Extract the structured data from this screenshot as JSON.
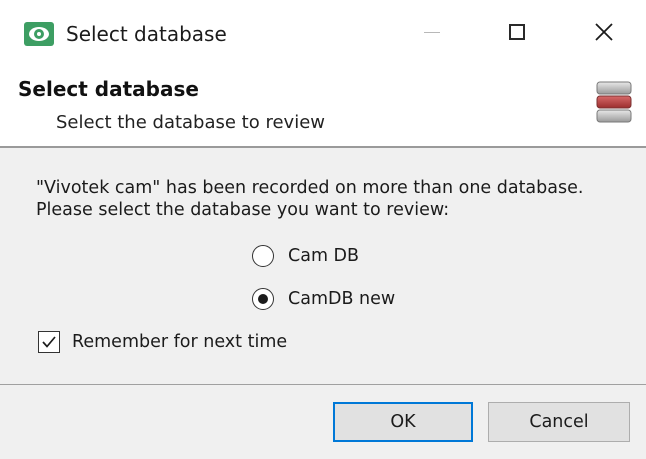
{
  "window": {
    "title": "Select database",
    "controls": {
      "minimize": "minimize",
      "maximize": "maximize",
      "close": "close"
    }
  },
  "header": {
    "title": "Select database",
    "subtitle": "Select the database to review",
    "icon": "database-icon"
  },
  "body": {
    "message_line1": "\"Vivotek cam\" has been recorded on more than one database.",
    "message_line2": "Please select the database you want to review:",
    "options": [
      {
        "label": "Cam DB",
        "selected": false
      },
      {
        "label": "CamDB new",
        "selected": true
      }
    ],
    "remember": {
      "label": "Remember for next time",
      "checked": true
    }
  },
  "footer": {
    "ok_label": "OK",
    "cancel_label": "Cancel"
  },
  "colors": {
    "accent": "#0078d7",
    "app_icon": "#3d9e63",
    "panel_bg": "#f0f0f0"
  }
}
